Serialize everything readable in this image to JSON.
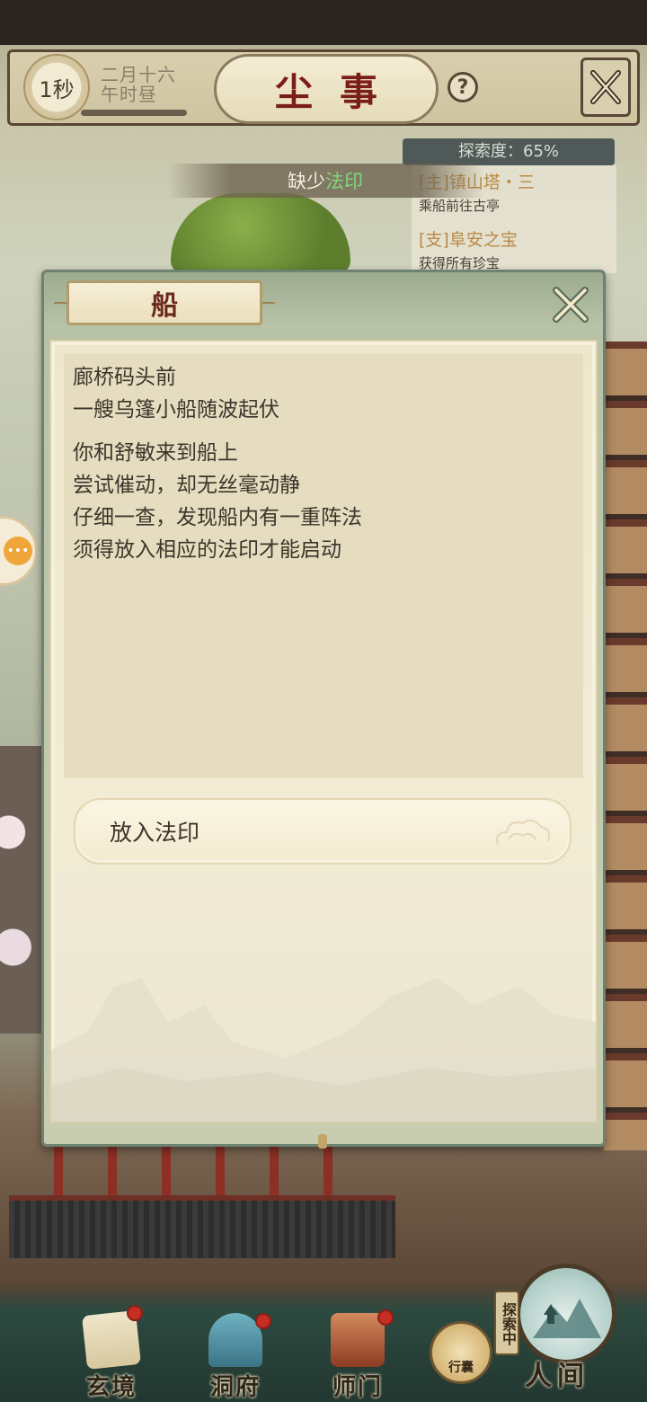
{
  "hud": {
    "timer": "1秒",
    "date_line1": "二月十六",
    "date_line2": "午时昼",
    "title": "尘事",
    "help_label": "?"
  },
  "quest": {
    "explore_label": "探索度：65%",
    "explore_progress_pct": 65,
    "items": [
      {
        "tag": "[主]镇山塔・三",
        "desc": "乘船前往古亭"
      },
      {
        "tag": "[支]阜安之宝",
        "desc": "获得所有珍宝"
      }
    ]
  },
  "notice": {
    "prefix": "缺少",
    "highlight": "法印"
  },
  "dialog": {
    "title": "船",
    "story_paragraph1": [
      "廊桥码头前",
      "一艘乌篷小船随波起伏"
    ],
    "story_paragraph2": [
      "你和舒敏来到船上",
      "尝试催动，却无丝毫动静",
      "仔细一查，发现船内有一重阵法",
      "须得放入相应的法印才能启动"
    ],
    "option_label": "放入法印"
  },
  "bottom_nav": {
    "items": [
      {
        "label": "玄境",
        "icon": "scroll-icon",
        "badge": true
      },
      {
        "label": "洞府",
        "icon": "pavilion-icon",
        "badge": true
      },
      {
        "label": "师门",
        "icon": "banner-icon",
        "badge": true
      }
    ],
    "bag_label": "行囊",
    "explore_tag": "探索中",
    "world_label": "人间"
  },
  "colors": {
    "accent_green": "#7fd87a",
    "title_red": "#7a1e18",
    "badge_red": "#c62d23",
    "quest_gold": "#b88a45"
  }
}
